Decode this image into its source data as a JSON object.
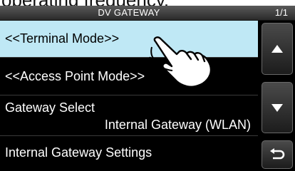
{
  "caption": "operating frequency.",
  "header": {
    "title": "DV GATEWAY",
    "page_indicator": "1/1"
  },
  "menu": {
    "items": [
      {
        "label": "<<Terminal Mode>>",
        "selected": true
      },
      {
        "label": "<<Access Point Mode>>",
        "selected": false
      },
      {
        "label": "Gateway Select",
        "value": "Internal Gateway (WLAN)",
        "selected": false
      },
      {
        "label": "Internal Gateway Settings",
        "selected": false
      }
    ]
  },
  "sidebar": {
    "up_icon": "triangle-up-icon",
    "down_icon": "triangle-down-icon",
    "back_icon": "return-arrow-icon"
  },
  "colors": {
    "selected_row": "#bfe8f5",
    "screen_background": "#000000",
    "text": "#ffffff"
  }
}
